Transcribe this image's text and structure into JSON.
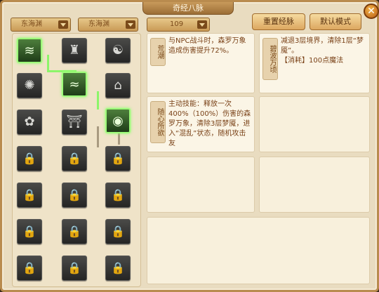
{
  "window": {
    "title": "奇经八脉",
    "close_label": "✕"
  },
  "filters": {
    "dropdown_1": "东海渊",
    "dropdown_2": "东海渊",
    "dropdown_3": "109"
  },
  "buttons": {
    "reset": "重置经脉",
    "default_mode": "默认模式"
  },
  "skill_grid": {
    "active_cells": [
      "r1c1",
      "r2c2",
      "r3c3"
    ],
    "rows": [
      [
        "wave",
        "figure",
        "swirl"
      ],
      [
        "wind",
        "waves",
        "tower"
      ],
      [
        "lotus",
        "gate",
        "orb"
      ],
      [
        "lock",
        "lock",
        "lock"
      ],
      [
        "lock",
        "lock",
        "lock"
      ],
      [
        "lock",
        "lock",
        "lock"
      ],
      [
        "lock",
        "lock",
        "lock"
      ]
    ]
  },
  "cards": [
    {
      "label": "荒潮",
      "text": "与NPC战斗时，森罗万象造成伤害提升72%。"
    },
    {
      "label": "碧波万顷",
      "text": "减退3层境界，清除1层“梦魇”。",
      "cost": "【消耗】100点魔法"
    },
    {
      "label": "随心所欲",
      "text": "主动技能：释放一次400%（100%）伤害的森罗万象，清除3层梦魇，进入“混乱”状态，随机攻击友"
    }
  ],
  "colors": {
    "active_border": "#9dfb7a",
    "panel_bg": "#e9dcc0",
    "text_brown": "#7a4218"
  }
}
